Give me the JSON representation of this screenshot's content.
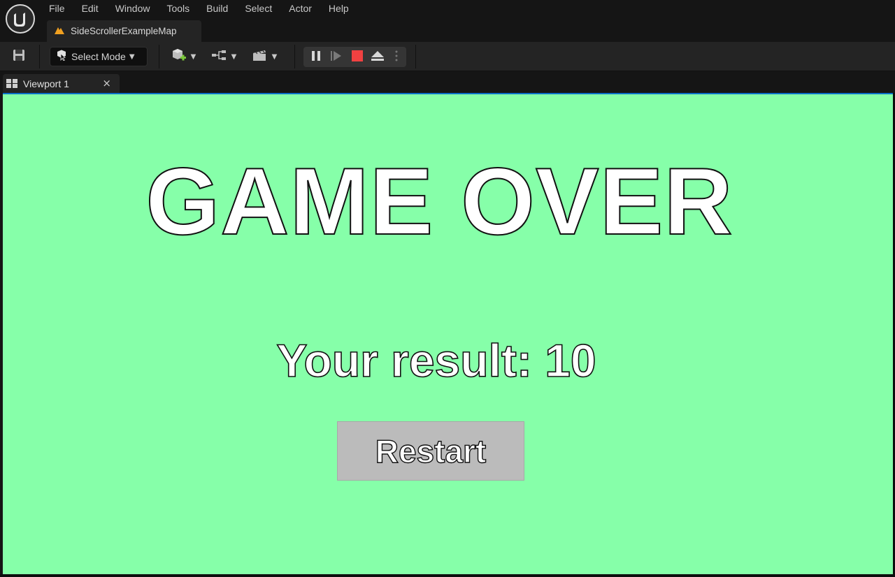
{
  "menu": {
    "items": [
      "File",
      "Edit",
      "Window",
      "Tools",
      "Build",
      "Select",
      "Actor",
      "Help"
    ]
  },
  "map_tab": {
    "label": "SideScrollerExampleMap"
  },
  "toolbar": {
    "select_mode_label": "Select Mode",
    "icons": [
      "save-icon",
      "add-actor-icon",
      "blueprint-icon",
      "cinematics-icon",
      "pause-icon",
      "step-icon",
      "stop-icon",
      "eject-icon",
      "more-options-icon"
    ]
  },
  "viewport_tab": {
    "label": "Viewport 1",
    "close": "×"
  },
  "game": {
    "title": "GAME OVER",
    "result_text": "Your result: 10",
    "restart_label": "Restart"
  },
  "colors": {
    "viewport_bg": "#86ffa9",
    "stop_red": "#f14141",
    "add_green": "#7cc83c",
    "map_warning_orange": "#f0a020",
    "button_gray": "#bbbbbb"
  }
}
